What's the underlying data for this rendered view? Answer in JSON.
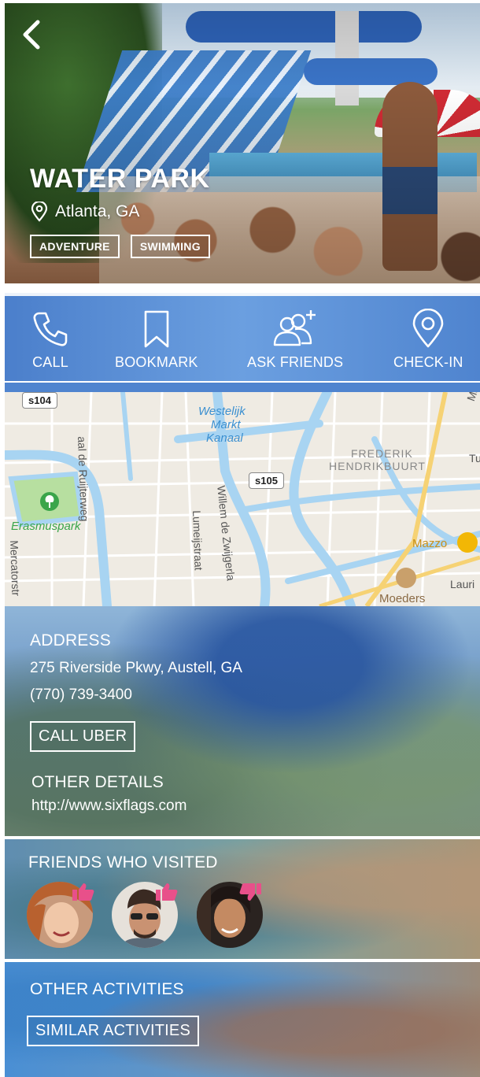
{
  "place": {
    "title": "WATER PARK",
    "location": "Atlanta, GA",
    "tags": [
      "ADVENTURE",
      "SWIMMING"
    ]
  },
  "actions": [
    {
      "label": "CALL",
      "icon": "phone-icon"
    },
    {
      "label": "BOOKMARK",
      "icon": "bookmark-icon"
    },
    {
      "label": "ASK FRIENDS",
      "icon": "add-friends-icon"
    },
    {
      "label": "CHECK-IN",
      "icon": "map-pin-icon"
    }
  ],
  "map": {
    "labels": {
      "s104": "s104",
      "s105": "s105",
      "westelijk": "Westelijk",
      "markt": "Markt",
      "kanaal": "Kanaal",
      "frederik": "FREDERIK",
      "hendrikbuurt": "HENDRIKBUURT",
      "erasmuspark": "Erasmuspark",
      "ruijterweg": "aal de Ruijterweg",
      "zwijger": "Willem de Zwijgerla",
      "lumeij": "Lumeijstraat",
      "mercator": "Mercatorstr",
      "mazzo": "Mazzo",
      "moeders": "Moeders",
      "lauri": "Lauri",
      "ma": "Ma",
      "tu": "Tu"
    }
  },
  "address": {
    "heading": "ADDRESS",
    "street": "275 Riverside Pkwy, Austell, GA",
    "phone": "(770) 739-3400",
    "uber_label": "CALL UBER",
    "other_heading": "OTHER DETAILS",
    "website": "http://www.sixflags.com"
  },
  "friends": {
    "heading": "FRIENDS WHO VISITED"
  },
  "other": {
    "heading": "OTHER ACTIVITIES",
    "similar_label": "SIMILAR ACTIVITIES"
  },
  "colors": {
    "action_bar": "#5a8ed6",
    "thumb": "#e8508a",
    "park_green": "#3aa54a"
  }
}
